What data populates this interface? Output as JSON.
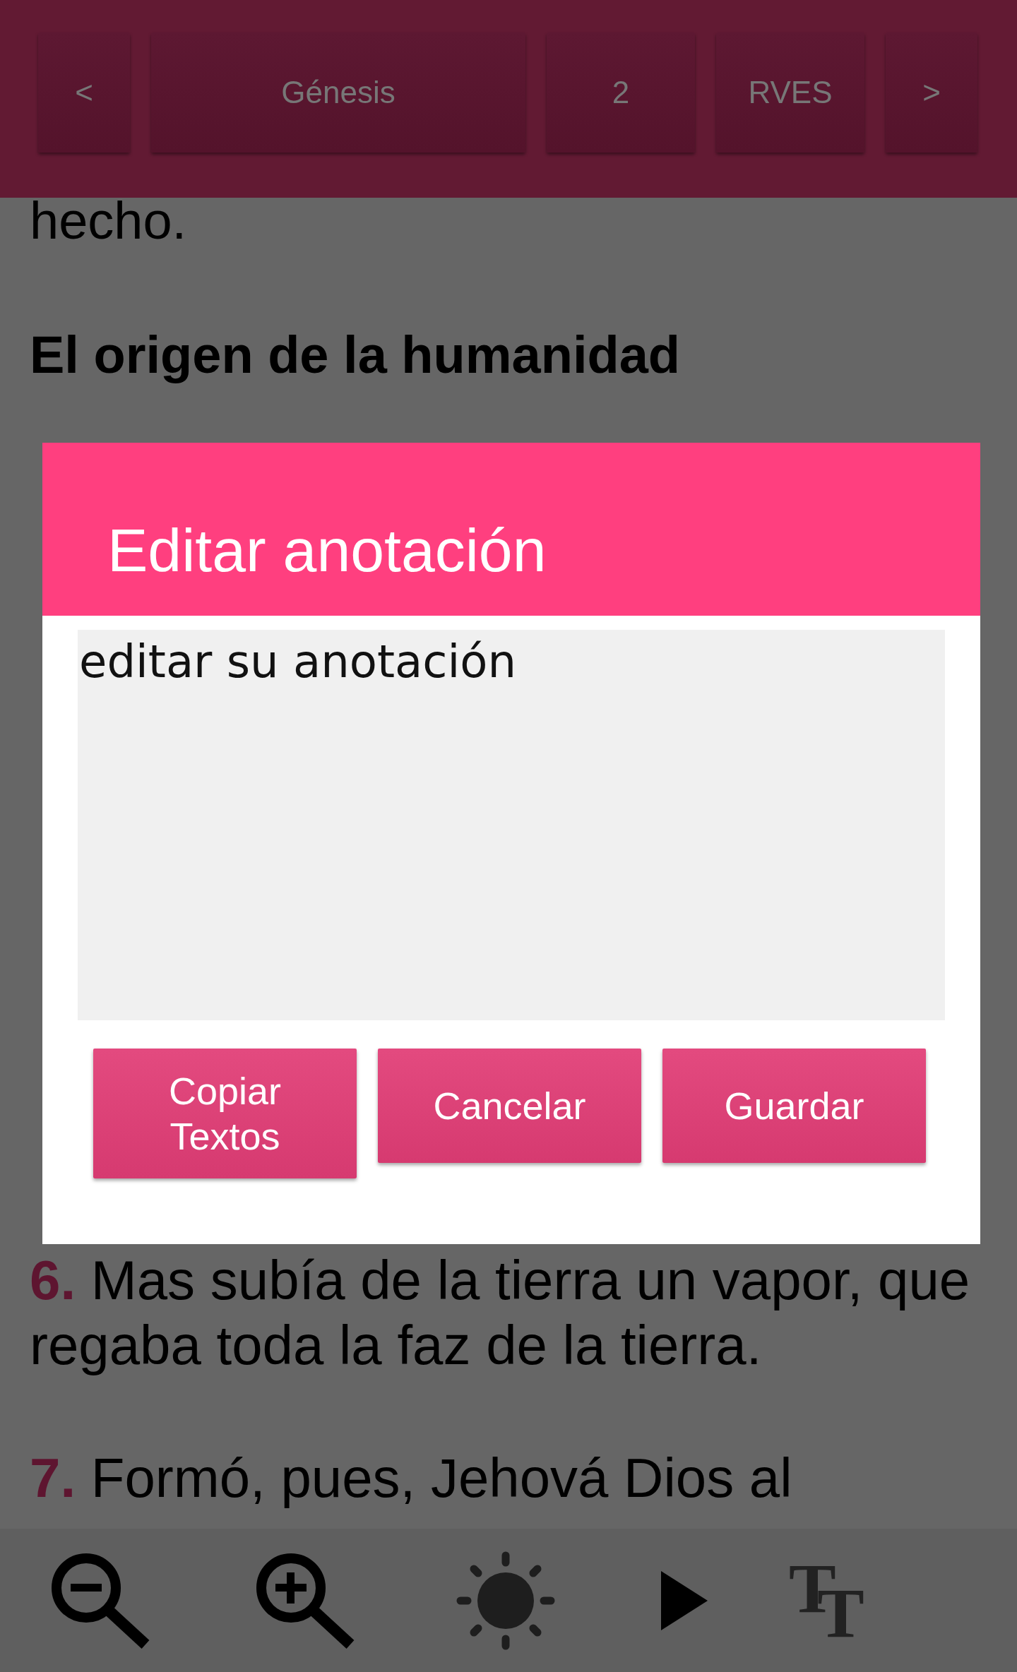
{
  "top_bar": {
    "buttons": [
      "<",
      "Génesis",
      "2",
      "RVES",
      ">"
    ]
  },
  "reading": {
    "blocks": [
      {
        "kind": "text",
        "text": "hecho."
      },
      {
        "kind": "heading",
        "text": "El origen de la humanidad"
      },
      {
        "kind": "verse",
        "number": "6.",
        "text": "Mas subía de la tierra un vapor, que regaba toda la faz de la tierra."
      },
      {
        "kind": "verse",
        "number": "7.",
        "text": "Formó, pues, Jehová Dios al"
      }
    ]
  },
  "dialog": {
    "title": "Editar anotación",
    "note": "editar su anotación",
    "buttons": [
      "Copiar Textos",
      "Cancelar",
      "Guardar"
    ]
  },
  "toolbar": {
    "text_size_glyphs": [
      "T",
      "T"
    ]
  }
}
